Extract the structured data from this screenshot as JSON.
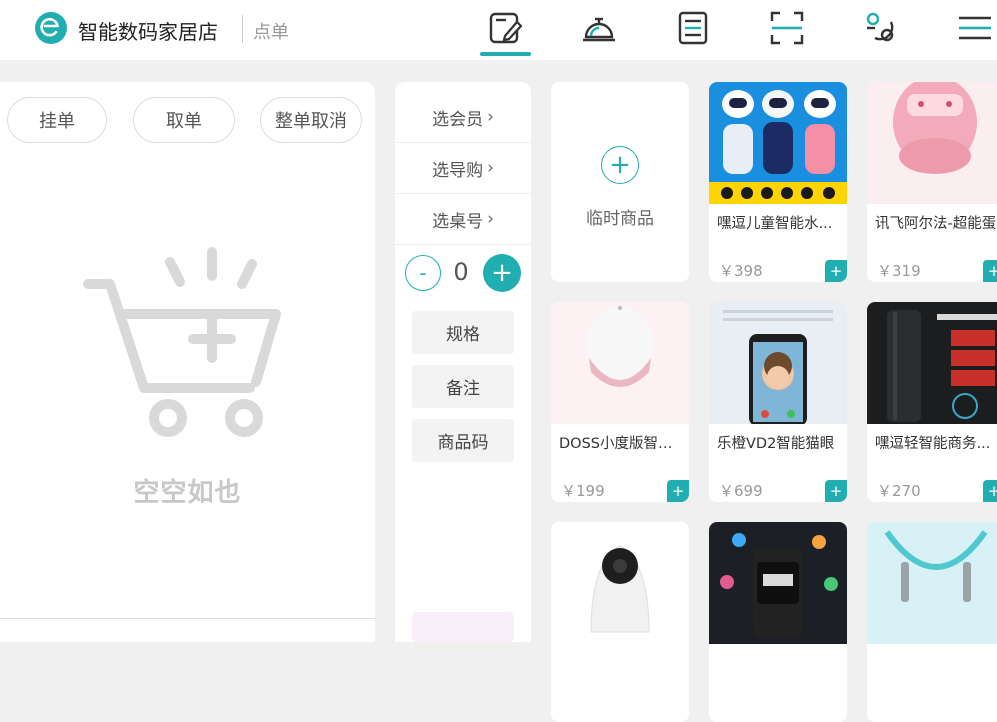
{
  "header": {
    "store_name": "智能数码家居店",
    "mode": "点单",
    "nav_icons": [
      "order-pad-icon",
      "service-bell-icon",
      "list-icon",
      "scan-icon",
      "settings-link-icon",
      "menu-icon"
    ]
  },
  "cart": {
    "actions": [
      "挂单",
      "取单",
      "整单取消"
    ],
    "empty_text": "空空如也"
  },
  "options": {
    "rows": [
      "选会员",
      "选导购",
      "选桌号"
    ],
    "chevron": "›",
    "qty": "0",
    "minus": "-",
    "plus": "+",
    "buttons": [
      "规格",
      "备注",
      "商品码"
    ]
  },
  "temp_product": {
    "label": "临时商品",
    "plus": "+"
  },
  "products": [
    {
      "name": "嘿逗儿童智能水...",
      "price": "￥398"
    },
    {
      "name": "讯飞阿尔法-超能蛋",
      "price": "￥319"
    },
    {
      "name": "DOSS小度版智能...",
      "price": "￥199"
    },
    {
      "name": "乐橙VD2智能猫眼",
      "price": "￥699"
    },
    {
      "name": "嘿逗轻智能商务...",
      "price": "￥270"
    }
  ],
  "add_label": "+",
  "colors": {
    "accent": "#20aeb0",
    "background": "#f0f0f0"
  }
}
